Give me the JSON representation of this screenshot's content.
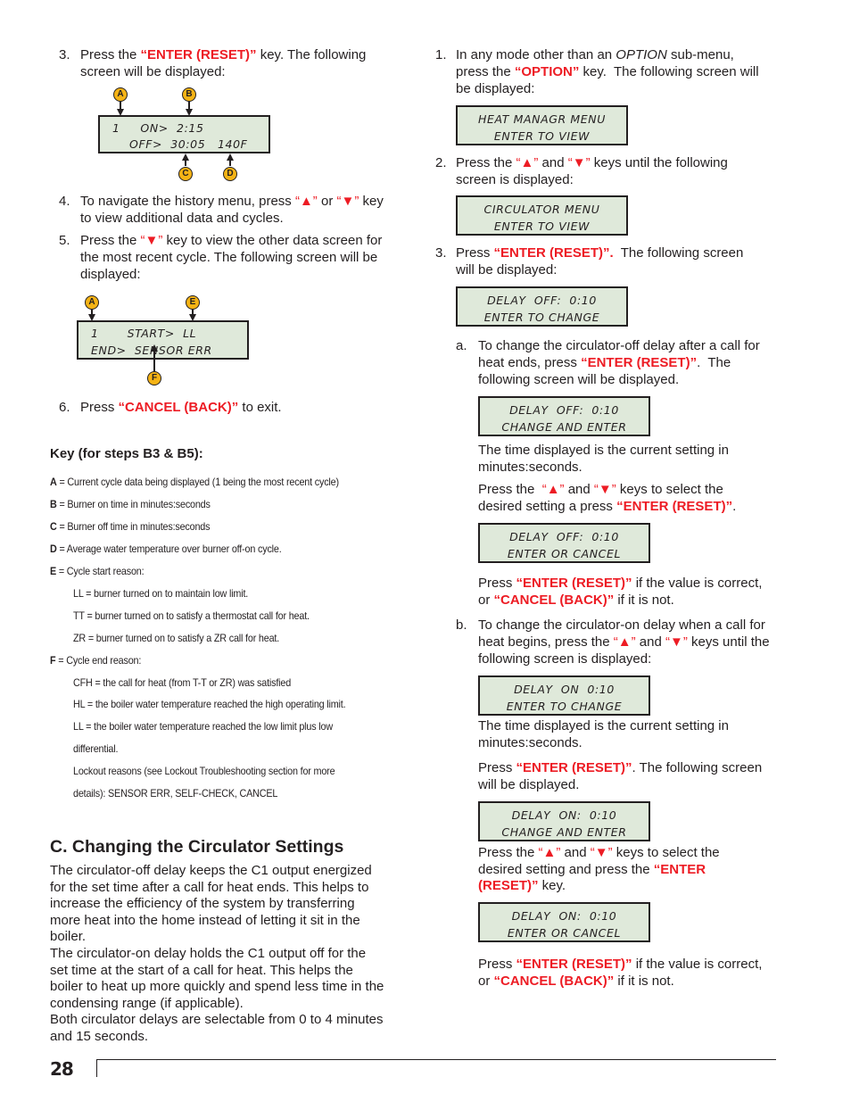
{
  "left_column": {
    "step3": {
      "number": "3.",
      "pre": "Press the ",
      "key": "“ENTER (RESET)”",
      "post_line1": " key. The following",
      "line2": "screen will be displayed:"
    },
    "lcd_history1": {
      "line1": "1     ON>  2:15",
      "line2": "OFF>  30:05   140F",
      "callouts": {
        "a": "A",
        "b": "B",
        "c": "C",
        "d": "D"
      }
    },
    "step4": {
      "number": "4.",
      "pre": "To navigate the history menu, press ",
      "up": "“▲”",
      "mid": " or ",
      "down": "“▼”",
      "post": " key",
      "line2": "to view additional data and cycles."
    },
    "step5": {
      "number": "5.",
      "pre": "Press the ",
      "down": "“▼”",
      "post": " key to view the other data screen for",
      "line2": "the most recent cycle.  The following screen will be",
      "line3": "displayed:"
    },
    "lcd_history2": {
      "line1": "1       START>  LL",
      "line2": "END>  SENSOR ERR",
      "callouts": {
        "a": "A",
        "e": "E",
        "f": "F"
      }
    },
    "step6": {
      "number": "6.",
      "pre": "Press ",
      "key": "“CANCEL (BACK)”",
      "post": " to exit."
    },
    "key_section": {
      "title": "Key (for steps B3 & B5):",
      "entries": [
        {
          "letter": "A",
          "text": " = Current cycle data being displayed (1 being the most recent cycle)"
        },
        {
          "letter": "B",
          "text": " = Burner on time in minutes:seconds"
        },
        {
          "letter": "C",
          "text": " = Burner off time in minutes:seconds"
        },
        {
          "letter": "D",
          "text": " = Average water temperature over burner off-on cycle."
        },
        {
          "letter": "E",
          "text": " = Cycle start reason:"
        }
      ],
      "start_reasons": [
        "LL = burner turned on to maintain low limit.",
        "TT = burner turned on to satisfy a thermostat call for heat.",
        "ZR = burner turned on to satisfy a ZR call for heat."
      ],
      "f_entry": {
        "letter": "F",
        "text": " = Cycle end reason:"
      },
      "end_reasons": [
        "CFH = the call for heat (from T-T or ZR) was satisfied",
        "HL = the boiler water temperature reached the high operating limit.",
        "LL = the boiler water temperature reached the low limit plus low",
        "differential.",
        "Lockout reasons (see Lockout Troubleshooting section for more",
        "details): SENSOR ERR,  SELF-CHECK, CANCEL"
      ]
    },
    "section_c": {
      "heading": "C. Changing the Circulator Settings",
      "paragraph_lines": [
        "The circulator-off delay keeps the C1 output energized",
        "for the set time after a call for heat ends.  This helps to",
        "increase the efficiency of the system by transferring",
        "more heat into the home instead of letting it sit in the",
        "boiler.",
        "The circulator-on delay holds the C1 output off for the",
        "set time at the start of a call for heat.  This helps the",
        "boiler to heat up more quickly and spend less time in the",
        "condensing range (if applicable).",
        "Both circulator delays are selectable from 0 to 4 minutes",
        "and 15 seconds."
      ]
    }
  },
  "right_column": {
    "step1": {
      "number": "1.",
      "pre": "In any mode other than an ",
      "italic": "OPTION",
      "post": " sub-menu,",
      "line2_pre": "press the ",
      "line2_key": "“OPTION”",
      "line2_post": " key.  The following screen will",
      "line3": "be displayed:"
    },
    "lcd_heat_manager": {
      "line1": "HEAT MANAGR MENU",
      "line2": "ENTER TO VIEW"
    },
    "step2": {
      "number": "2.",
      "pre": "Press the ",
      "up": "“▲”",
      "mid": " and ",
      "down": "“▼”",
      "post": " keys until the following",
      "line2": "screen is displayed:"
    },
    "lcd_circulator_menu": {
      "line1": "CIRCULATOR MENU",
      "line2": "ENTER TO VIEW"
    },
    "step3": {
      "number": "3.",
      "pre": "Press ",
      "key": "“ENTER (RESET)”.",
      "post": "  The following screen",
      "line2": "will be displayed:"
    },
    "lcd_delay_off_view": {
      "line1": "DELAY  OFF:  0:10",
      "line2": "ENTER TO CHANGE"
    },
    "sub_a": {
      "letter": "a.",
      "line1": "To change the circulator-off delay after a call for",
      "line2_pre": "heat ends, press ",
      "line2_key": "“ENTER (RESET)”",
      "line2_post": ".  The",
      "line3": "following screen will be displayed."
    },
    "lcd_delay_off_change": {
      "line1": "DELAY  OFF:  0:10",
      "line2": "CHANGE AND ENTER"
    },
    "sub_a_time_note": {
      "line1": "The time displayed is the current setting in",
      "line2": "minutes:seconds."
    },
    "sub_a_select": {
      "pre": "Press the  ",
      "up": "“▲”",
      "mid": " and ",
      "down": "“▼”",
      "post": " keys to select the",
      "line2_pre": "desired setting a press ",
      "line2_key": "“ENTER (RESET)”",
      "line2_post": "."
    },
    "lcd_delay_off_confirm": {
      "line1": "DELAY  OFF:  0:10",
      "line2": "ENTER OR CANCEL"
    },
    "sub_a_confirm": {
      "pre": "Press ",
      "key1": "“ENTER (RESET)”",
      "mid": " if the value is correct,",
      "line2_pre": "or ",
      "key2": "“CANCEL (BACK)”",
      "line2_post": " if it is not."
    },
    "sub_b": {
      "letter": "b.",
      "line1": "To change the circulator-on delay when a call for",
      "line2_pre": "heat begins, press the ",
      "up": "“▲”",
      "mid": " and ",
      "down": "“▼”",
      "line2_post": " keys until the",
      "line3": "following screen is displayed:"
    },
    "lcd_delay_on_view": {
      "line1": "DELAY  ON  0:10",
      "line2": "ENTER TO CHANGE"
    },
    "sub_b_time_note": {
      "line1": "The time displayed is the current setting in",
      "line2": "minutes:seconds."
    },
    "sub_b_enter": {
      "pre": "Press ",
      "key": "“ENTER (RESET)”",
      "post": ". The following screen",
      "line2": "will be displayed."
    },
    "lcd_delay_on_change": {
      "line1": "DELAY  ON:  0:10",
      "line2": "CHANGE AND ENTER"
    },
    "sub_b_select": {
      "pre": "Press the ",
      "up": "“▲”",
      "mid": " and ",
      "down": "“▼”",
      "post": " keys to select the",
      "line2_pre": "desired setting and press the ",
      "line2_key": "“ENTER",
      "line3_key": "(RESET)”",
      "line3_post": " key."
    },
    "lcd_delay_on_confirm": {
      "line1": "DELAY  ON:  0:10",
      "line2": "ENTER OR CANCEL"
    },
    "sub_b_confirm": {
      "pre": "Press ",
      "key1": "“ENTER (RESET)”",
      "mid": " if the value is correct,",
      "line2_pre": "or ",
      "key2": "“CANCEL (BACK)”",
      "line2_post": " if it is not."
    }
  },
  "footer": {
    "page_number": "28"
  },
  "colors": {
    "key_red": "#ed1c24",
    "lcd_bg": "#dfe9da",
    "callout_fill": "#f5b315",
    "text": "#231f20"
  }
}
